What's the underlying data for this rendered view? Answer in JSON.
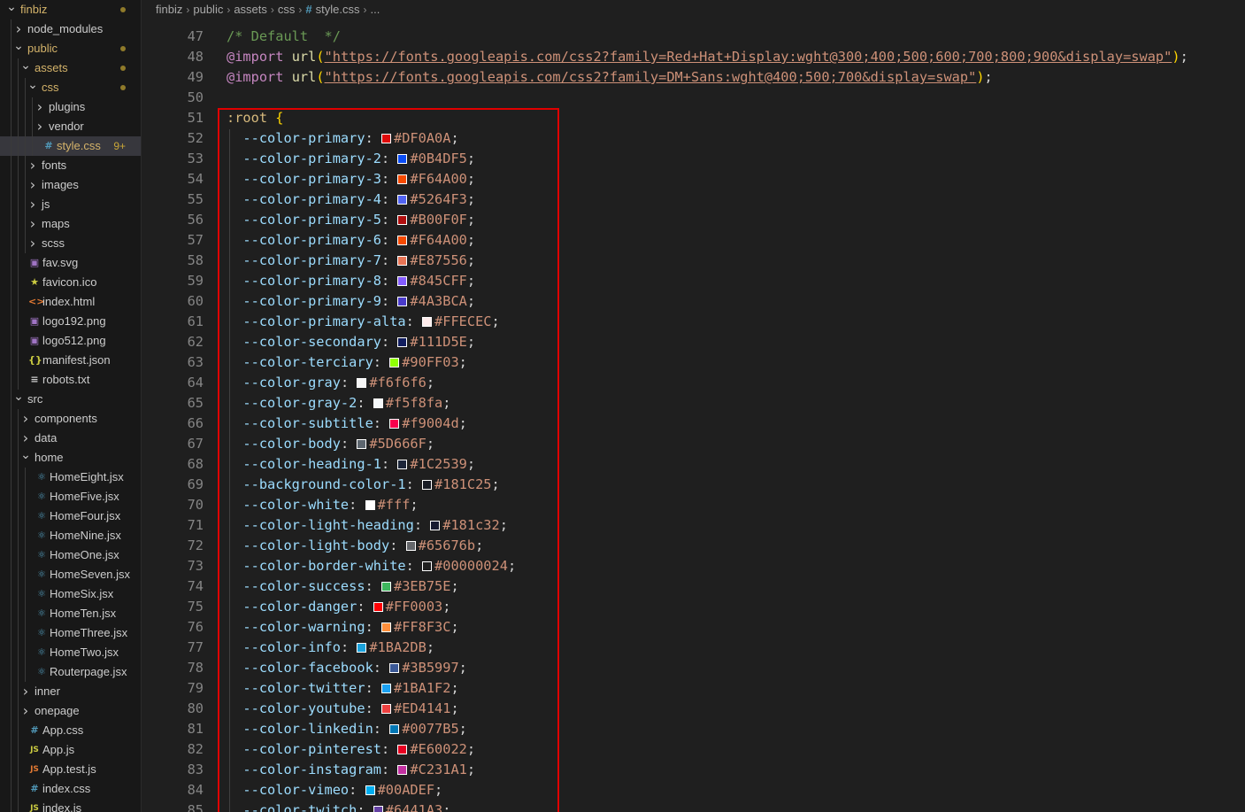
{
  "explorer": {
    "rows": [
      {
        "label": "finbiz",
        "kind": "folder-open",
        "depth": 0,
        "color": "#d4b36a",
        "dot": true,
        "name": "tree-folder-finbiz"
      },
      {
        "label": "node_modules",
        "kind": "folder-closed",
        "depth": 1,
        "color": "#cccccc",
        "name": "tree-folder-node-modules"
      },
      {
        "label": "public",
        "kind": "folder-open",
        "depth": 1,
        "color": "#d4b36a",
        "dot": true,
        "name": "tree-folder-public"
      },
      {
        "label": "assets",
        "kind": "folder-open",
        "depth": 2,
        "color": "#d4b36a",
        "dot": true,
        "name": "tree-folder-assets"
      },
      {
        "label": "css",
        "kind": "folder-open",
        "depth": 3,
        "color": "#d4b36a",
        "dot": true,
        "name": "tree-folder-css"
      },
      {
        "label": "plugins",
        "kind": "folder-closed",
        "depth": 4,
        "color": "#cccccc",
        "name": "tree-folder-plugins"
      },
      {
        "label": "vendor",
        "kind": "folder-closed",
        "depth": 4,
        "color": "#cccccc",
        "name": "tree-folder-vendor"
      },
      {
        "label": "style.css",
        "kind": "file",
        "depth": 4,
        "icon": "#",
        "icon_color": "#519aba",
        "color": "#d4b36a",
        "count": "9+",
        "selected": true,
        "name": "tree-file-style-css"
      },
      {
        "label": "fonts",
        "kind": "folder-closed",
        "depth": 3,
        "color": "#cccccc",
        "name": "tree-folder-fonts"
      },
      {
        "label": "images",
        "kind": "folder-closed",
        "depth": 3,
        "color": "#cccccc",
        "name": "tree-folder-images"
      },
      {
        "label": "js",
        "kind": "folder-closed",
        "depth": 3,
        "color": "#cccccc",
        "name": "tree-folder-js"
      },
      {
        "label": "maps",
        "kind": "folder-closed",
        "depth": 3,
        "color": "#cccccc",
        "name": "tree-folder-maps"
      },
      {
        "label": "scss",
        "kind": "folder-closed",
        "depth": 3,
        "color": "#cccccc",
        "name": "tree-folder-scss"
      },
      {
        "label": "fav.svg",
        "kind": "file",
        "depth": 2,
        "icon": "▣",
        "icon_color": "#a074c4",
        "color": "#cccccc",
        "name": "tree-file-fav-svg"
      },
      {
        "label": "favicon.ico",
        "kind": "file",
        "depth": 2,
        "icon": "★",
        "icon_color": "#cbcb41",
        "color": "#cccccc",
        "name": "tree-file-favicon-ico"
      },
      {
        "label": "index.html",
        "kind": "file",
        "depth": 2,
        "icon": "<>",
        "icon_color": "#e37933",
        "color": "#cccccc",
        "name": "tree-file-index-html"
      },
      {
        "label": "logo192.png",
        "kind": "file",
        "depth": 2,
        "icon": "▣",
        "icon_color": "#a074c4",
        "color": "#cccccc",
        "name": "tree-file-logo192-png"
      },
      {
        "label": "logo512.png",
        "kind": "file",
        "depth": 2,
        "icon": "▣",
        "icon_color": "#a074c4",
        "color": "#cccccc",
        "name": "tree-file-logo512-png"
      },
      {
        "label": "manifest.json",
        "kind": "file",
        "depth": 2,
        "icon": "{}",
        "icon_color": "#cbcb41",
        "color": "#cccccc",
        "name": "tree-file-manifest-json"
      },
      {
        "label": "robots.txt",
        "kind": "file",
        "depth": 2,
        "icon": "≡",
        "icon_color": "#cccccc",
        "color": "#cccccc",
        "name": "tree-file-robots-txt"
      },
      {
        "label": "src",
        "kind": "folder-open",
        "depth": 1,
        "color": "#cccccc",
        "name": "tree-folder-src"
      },
      {
        "label": "components",
        "kind": "folder-closed",
        "depth": 2,
        "color": "#cccccc",
        "name": "tree-folder-components"
      },
      {
        "label": "data",
        "kind": "folder-closed",
        "depth": 2,
        "color": "#cccccc",
        "name": "tree-folder-data"
      },
      {
        "label": "home",
        "kind": "folder-open",
        "depth": 2,
        "color": "#cccccc",
        "name": "tree-folder-home"
      },
      {
        "label": "HomeEight.jsx",
        "kind": "file",
        "depth": 3,
        "icon": "⚛",
        "icon_color": "#519aba",
        "color": "#cccccc",
        "name": "tree-file-homeeight"
      },
      {
        "label": "HomeFive.jsx",
        "kind": "file",
        "depth": 3,
        "icon": "⚛",
        "icon_color": "#519aba",
        "color": "#cccccc",
        "name": "tree-file-homefive"
      },
      {
        "label": "HomeFour.jsx",
        "kind": "file",
        "depth": 3,
        "icon": "⚛",
        "icon_color": "#519aba",
        "color": "#cccccc",
        "name": "tree-file-homefour"
      },
      {
        "label": "HomeNine.jsx",
        "kind": "file",
        "depth": 3,
        "icon": "⚛",
        "icon_color": "#519aba",
        "color": "#cccccc",
        "name": "tree-file-homenine"
      },
      {
        "label": "HomeOne.jsx",
        "kind": "file",
        "depth": 3,
        "icon": "⚛",
        "icon_color": "#519aba",
        "color": "#cccccc",
        "name": "tree-file-homeone"
      },
      {
        "label": "HomeSeven.jsx",
        "kind": "file",
        "depth": 3,
        "icon": "⚛",
        "icon_color": "#519aba",
        "color": "#cccccc",
        "name": "tree-file-homeseven"
      },
      {
        "label": "HomeSix.jsx",
        "kind": "file",
        "depth": 3,
        "icon": "⚛",
        "icon_color": "#519aba",
        "color": "#cccccc",
        "name": "tree-file-homesix"
      },
      {
        "label": "HomeTen.jsx",
        "kind": "file",
        "depth": 3,
        "icon": "⚛",
        "icon_color": "#519aba",
        "color": "#cccccc",
        "name": "tree-file-hometen"
      },
      {
        "label": "HomeThree.jsx",
        "kind": "file",
        "depth": 3,
        "icon": "⚛",
        "icon_color": "#519aba",
        "color": "#cccccc",
        "name": "tree-file-homethree"
      },
      {
        "label": "HomeTwo.jsx",
        "kind": "file",
        "depth": 3,
        "icon": "⚛",
        "icon_color": "#519aba",
        "color": "#cccccc",
        "name": "tree-file-hometwo"
      },
      {
        "label": "Routerpage.jsx",
        "kind": "file",
        "depth": 3,
        "icon": "⚛",
        "icon_color": "#519aba",
        "color": "#cccccc",
        "name": "tree-file-routerpage"
      },
      {
        "label": "inner",
        "kind": "folder-closed",
        "depth": 2,
        "color": "#cccccc",
        "name": "tree-folder-inner"
      },
      {
        "label": "onepage",
        "kind": "folder-closed",
        "depth": 2,
        "color": "#cccccc",
        "name": "tree-folder-onepage"
      },
      {
        "label": "App.css",
        "kind": "file",
        "depth": 2,
        "icon": "#",
        "icon_color": "#519aba",
        "color": "#cccccc",
        "name": "tree-file-app-css"
      },
      {
        "label": "App.js",
        "kind": "file",
        "depth": 2,
        "icon": "JS",
        "icon_color": "#cbcb41",
        "color": "#cccccc",
        "name": "tree-file-app-js"
      },
      {
        "label": "App.test.js",
        "kind": "file",
        "depth": 2,
        "icon": "JS",
        "icon_color": "#e37933",
        "color": "#cccccc",
        "name": "tree-file-app-test-js"
      },
      {
        "label": "index.css",
        "kind": "file",
        "depth": 2,
        "icon": "#",
        "icon_color": "#519aba",
        "color": "#cccccc",
        "name": "tree-file-index-css"
      },
      {
        "label": "index.js",
        "kind": "file",
        "depth": 2,
        "icon": "JS",
        "icon_color": "#cbcb41",
        "color": "#cccccc",
        "name": "tree-file-index-js"
      }
    ]
  },
  "breadcrumb": {
    "items": [
      "finbiz",
      "public",
      "assets",
      "css"
    ],
    "file": "style.css",
    "file_icon": "#",
    "trail": "..."
  },
  "code": {
    "header_lines": [
      {
        "n": "47",
        "type": "comment",
        "text": "/* Default  */"
      },
      {
        "n": "48",
        "type": "import",
        "at": "@import",
        "fn": "url",
        "url": "\"https://fonts.googleapis.com/css2?family=Red+Hat+Display:wght@300;400;500;600;700;800;900&display=swap\""
      },
      {
        "n": "49",
        "type": "import",
        "at": "@import",
        "fn": "url",
        "url": "\"https://fonts.googleapis.com/css2?family=DM+Sans:wght@400;500;700&display=swap\""
      },
      {
        "n": "50",
        "type": "blank",
        "text": ""
      },
      {
        "n": "51",
        "type": "selector",
        "selector": ":root",
        "brace": "{"
      }
    ],
    "vars": [
      {
        "n": "52",
        "name": "--color-primary",
        "value": "#DF0A0A",
        "swatch": "#DF0A0A"
      },
      {
        "n": "53",
        "name": "--color-primary-2",
        "value": "#0B4DF5",
        "swatch": "#0B4DF5"
      },
      {
        "n": "54",
        "name": "--color-primary-3",
        "value": "#F64A00",
        "swatch": "#F64A00"
      },
      {
        "n": "55",
        "name": "--color-primary-4",
        "value": "#5264F3",
        "swatch": "#5264F3"
      },
      {
        "n": "56",
        "name": "--color-primary-5",
        "value": "#B00F0F",
        "swatch": "#B00F0F"
      },
      {
        "n": "57",
        "name": "--color-primary-6",
        "value": "#F64A00",
        "swatch": "#F64A00"
      },
      {
        "n": "58",
        "name": "--color-primary-7",
        "value": "#E87556",
        "swatch": "#E87556"
      },
      {
        "n": "59",
        "name": "--color-primary-8",
        "value": "#845CFF",
        "swatch": "#845CFF"
      },
      {
        "n": "60",
        "name": "--color-primary-9",
        "value": "#4A3BCA",
        "swatch": "#4A3BCA"
      },
      {
        "n": "61",
        "name": "--color-primary-alta",
        "value": "#FFECEC",
        "swatch": "#FFECEC"
      },
      {
        "n": "62",
        "name": "--color-secondary",
        "value": "#111D5E",
        "swatch": "#111D5E"
      },
      {
        "n": "63",
        "name": "--color-terciary",
        "value": "#90FF03",
        "swatch": "#90FF03"
      },
      {
        "n": "64",
        "name": "--color-gray",
        "value": "#f6f6f6",
        "swatch": "#f6f6f6"
      },
      {
        "n": "65",
        "name": "--color-gray-2",
        "value": "#f5f8fa",
        "swatch": "#f5f8fa"
      },
      {
        "n": "66",
        "name": "--color-subtitle",
        "value": "#f9004d",
        "swatch": "#f9004d"
      },
      {
        "n": "67",
        "name": "--color-body",
        "value": "#5D666F",
        "swatch": "#5D666F"
      },
      {
        "n": "68",
        "name": "--color-heading-1",
        "value": "#1C2539",
        "swatch": "#1C2539"
      },
      {
        "n": "69",
        "name": "--background-color-1",
        "value": "#181C25",
        "swatch": "#181C25"
      },
      {
        "n": "70",
        "name": "--color-white",
        "value": "#fff",
        "swatch": "#ffffff"
      },
      {
        "n": "71",
        "name": "--color-light-heading",
        "value": "#181c32",
        "swatch": "#181c32"
      },
      {
        "n": "72",
        "name": "--color-light-body",
        "value": "#65676b",
        "swatch": "#65676b"
      },
      {
        "n": "73",
        "name": "--color-border-white",
        "value": "#00000024",
        "swatch": "#1f1f1f"
      },
      {
        "n": "74",
        "name": "--color-success",
        "value": "#3EB75E",
        "swatch": "#3EB75E"
      },
      {
        "n": "75",
        "name": "--color-danger",
        "value": "#FF0003",
        "swatch": "#FF0003"
      },
      {
        "n": "76",
        "name": "--color-warning",
        "value": "#FF8F3C",
        "swatch": "#FF8F3C"
      },
      {
        "n": "77",
        "name": "--color-info",
        "value": "#1BA2DB",
        "swatch": "#1BA2DB"
      },
      {
        "n": "78",
        "name": "--color-facebook",
        "value": "#3B5997",
        "swatch": "#3B5997"
      },
      {
        "n": "79",
        "name": "--color-twitter",
        "value": "#1BA1F2",
        "swatch": "#1BA1F2"
      },
      {
        "n": "80",
        "name": "--color-youtube",
        "value": "#ED4141",
        "swatch": "#ED4141"
      },
      {
        "n": "81",
        "name": "--color-linkedin",
        "value": "#0077B5",
        "swatch": "#0077B5"
      },
      {
        "n": "82",
        "name": "--color-pinterest",
        "value": "#E60022",
        "swatch": "#E60022"
      },
      {
        "n": "83",
        "name": "--color-instagram",
        "value": "#C231A1",
        "swatch": "#C231A1"
      },
      {
        "n": "84",
        "name": "--color-vimeo",
        "value": "#00ADEF",
        "swatch": "#00ADEF"
      },
      {
        "n": "85",
        "name": "--color-twitch",
        "value": "#6441A3",
        "swatch": "#6441A3"
      }
    ]
  },
  "colors": {
    "highlight_box": "#e00000",
    "accent_folder": "#d4b36a",
    "selected_row": "#37373d"
  }
}
